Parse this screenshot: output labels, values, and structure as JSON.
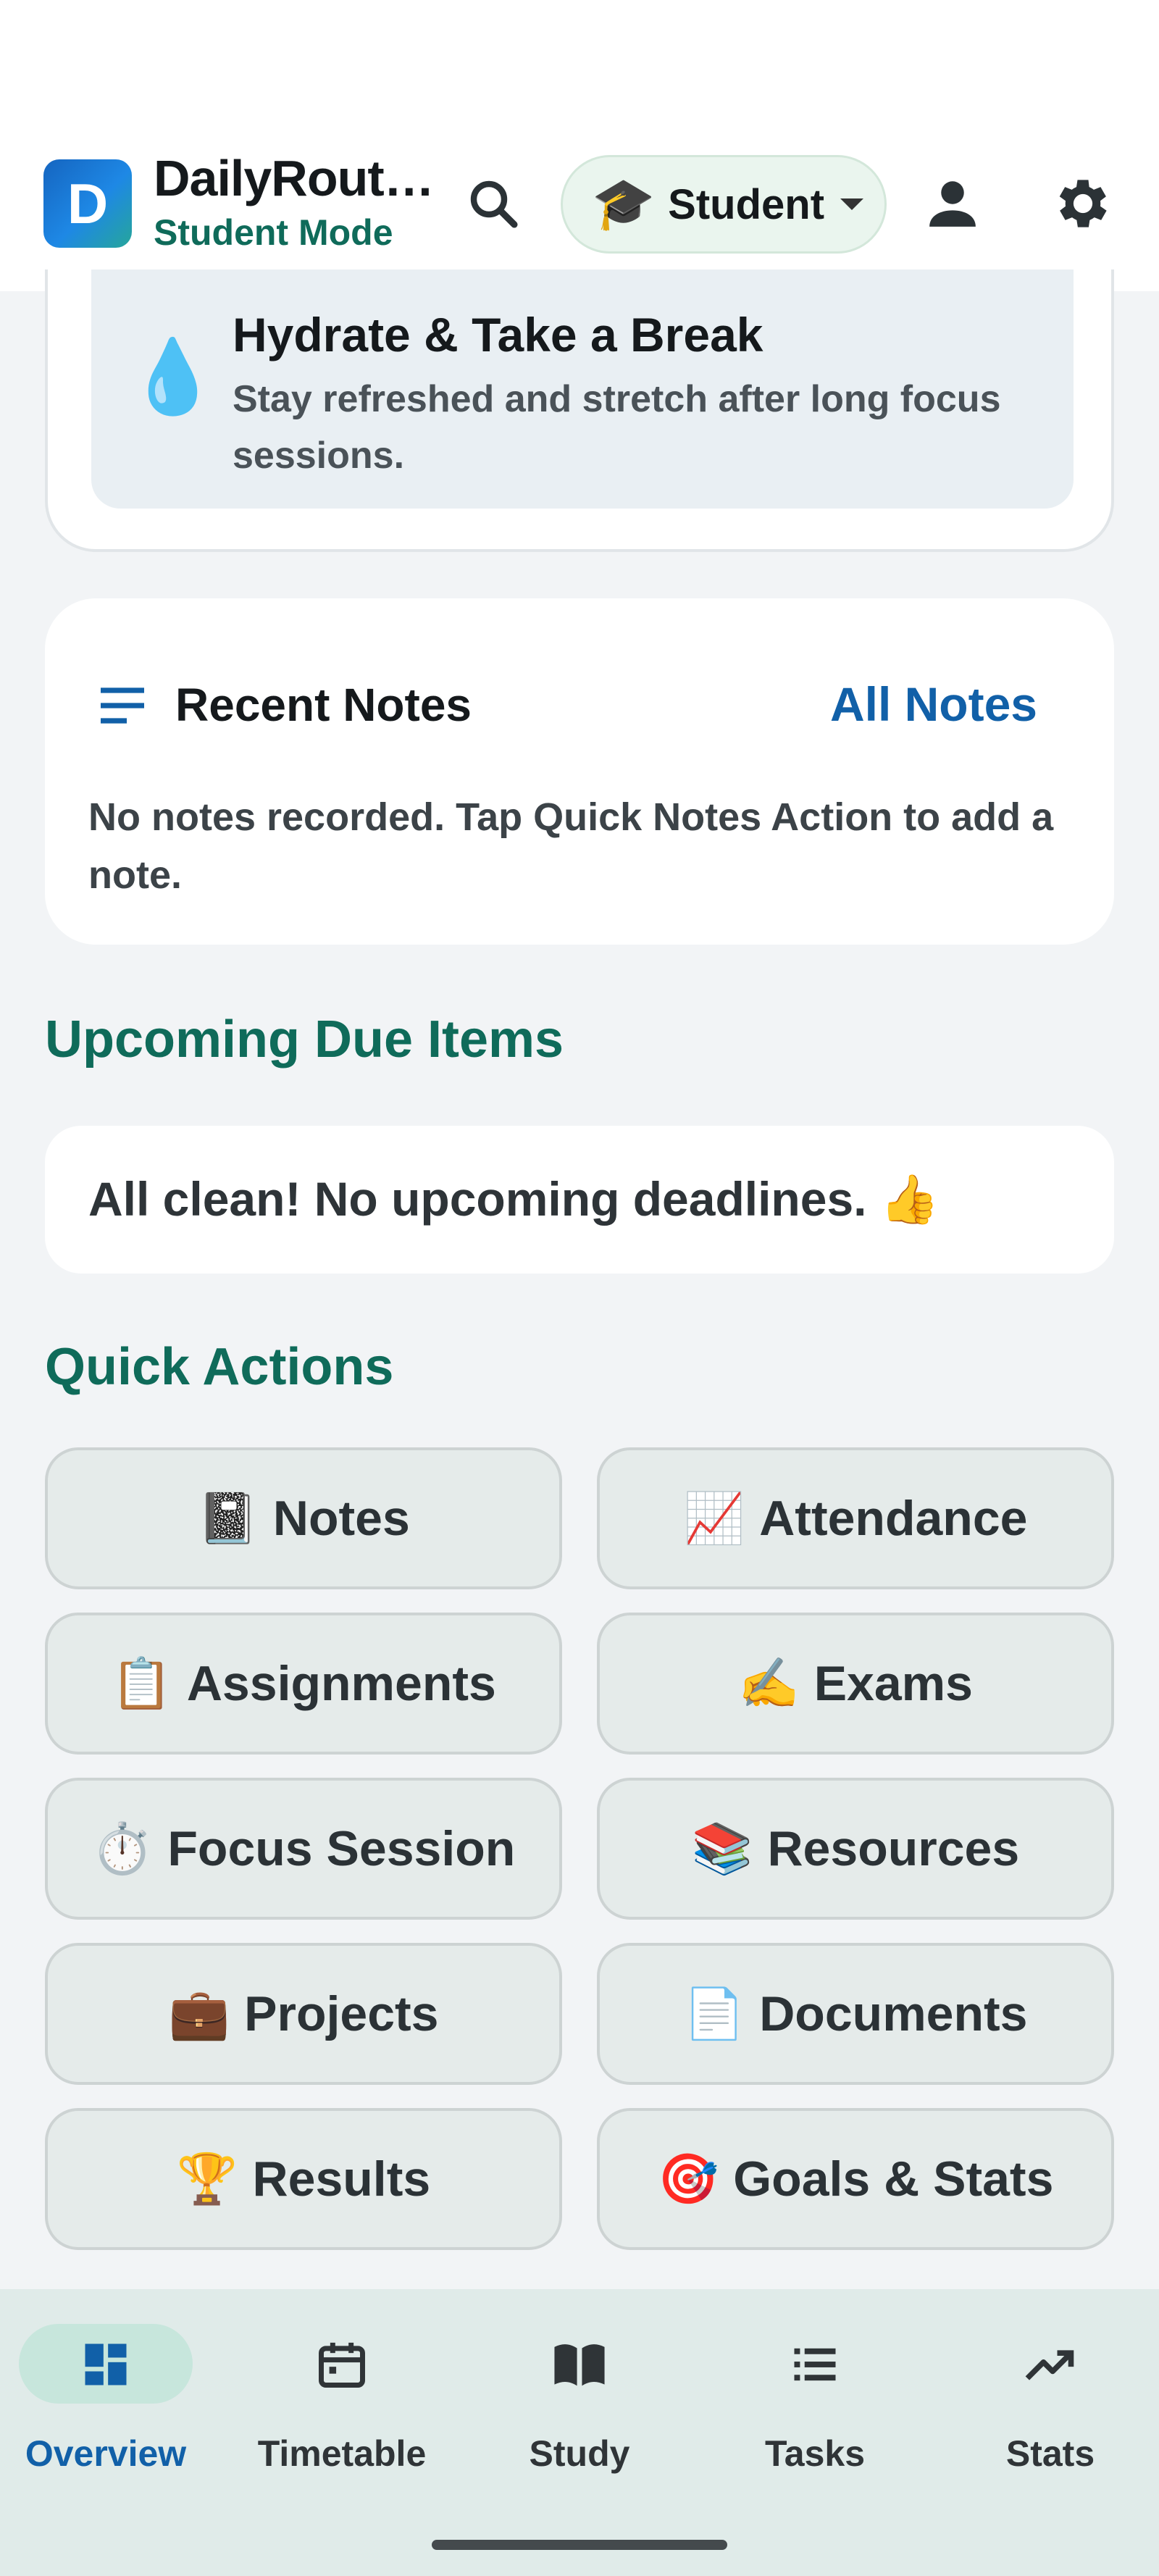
{
  "app": {
    "title": "DailyRout…",
    "logo_letter": "D",
    "subtitle": "Student Mode",
    "mode_chip_label": "Student",
    "mode_chip_icon": "🎓"
  },
  "tip": {
    "icon": "💧",
    "title": "Hydrate & Take a Break",
    "text": "Stay refreshed and stretch after long focus sessions."
  },
  "recent_notes": {
    "title": "Recent Notes",
    "link": "All Notes",
    "empty_text": "No notes recorded. Tap Quick Notes Action to add a note."
  },
  "upcoming": {
    "heading": "Upcoming Due Items",
    "empty_text": "All clean! No upcoming deadlines. 👍"
  },
  "quick_actions": {
    "heading": "Quick Actions",
    "items": [
      {
        "emoji": "📓",
        "label": "Notes"
      },
      {
        "emoji": "📈",
        "label": "Attendance"
      },
      {
        "emoji": "📋",
        "label": "Assignments"
      },
      {
        "emoji": "✍️",
        "label": "Exams"
      },
      {
        "emoji": "⏱️",
        "label": "Focus Session"
      },
      {
        "emoji": "📚",
        "label": "Resources"
      },
      {
        "emoji": "💼",
        "label": "Projects"
      },
      {
        "emoji": "📄",
        "label": "Documents"
      },
      {
        "emoji": "🏆",
        "label": "Results"
      },
      {
        "emoji": "🎯",
        "label": "Goals & Stats"
      }
    ]
  },
  "bottom_nav": {
    "items": [
      {
        "label": "Overview",
        "icon": "dashboard-icon",
        "active": true
      },
      {
        "label": "Timetable",
        "icon": "calendar-icon",
        "active": false
      },
      {
        "label": "Study",
        "icon": "book-icon",
        "active": false
      },
      {
        "label": "Tasks",
        "icon": "list-icon",
        "active": false
      },
      {
        "label": "Stats",
        "icon": "trending-up-icon",
        "active": false
      }
    ]
  },
  "colors": {
    "accent": "#0f6b5a",
    "link": "#1160a8",
    "nav_bg": "#e0ebe9"
  }
}
